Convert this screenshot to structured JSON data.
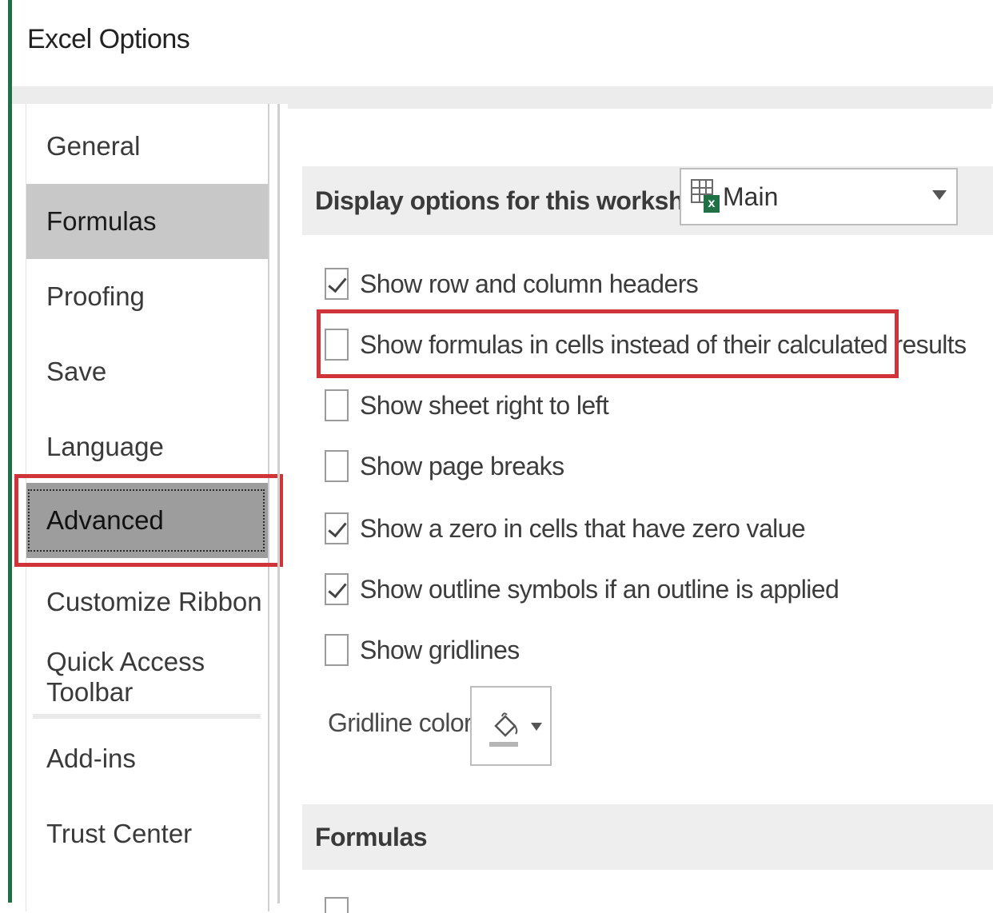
{
  "dialog": {
    "title": "Excel Options"
  },
  "sidebar": {
    "items": [
      {
        "label": "General"
      },
      {
        "label": "Formulas"
      },
      {
        "label": "Proofing"
      },
      {
        "label": "Save"
      },
      {
        "label": "Language"
      },
      {
        "label": "Advanced"
      },
      {
        "label": "Customize Ribbon"
      },
      {
        "label": "Quick Access Toolbar"
      },
      {
        "label": "Add-ins"
      },
      {
        "label": "Trust Center"
      }
    ],
    "selected": "Advanced"
  },
  "display_section": {
    "header": "Display options for this worksheet:",
    "worksheet_select": {
      "value": "Main",
      "icon": "excel-sheet-icon"
    },
    "options": [
      {
        "label": "Show row and column headers",
        "checked": true
      },
      {
        "label": "Show formulas in cells instead of their calculated results",
        "checked": false,
        "highlighted": true
      },
      {
        "label": "Show sheet right to left",
        "checked": false
      },
      {
        "label": "Show page breaks",
        "checked": false
      },
      {
        "label": "Show a zero in cells that have zero value",
        "checked": true
      },
      {
        "label": "Show outline symbols if an outline is applied",
        "checked": true
      },
      {
        "label": "Show gridlines",
        "checked": false
      }
    ],
    "gridline_color_label": "Gridline color",
    "gridline_color_icon": "paint-bucket-icon"
  },
  "formulas_section": {
    "header": "Formulas"
  },
  "colors": {
    "accent": "#1e7145",
    "highlight": "#d13438",
    "selected_nav": "#9d9d9d"
  }
}
